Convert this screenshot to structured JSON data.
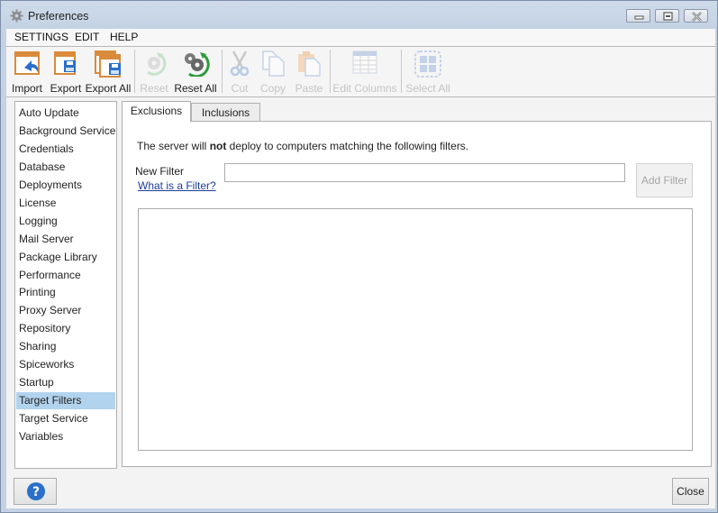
{
  "window": {
    "title": "Preferences",
    "controls": {
      "minimize": "minimize",
      "maximize": "maximize",
      "close": "close"
    }
  },
  "menu": [
    {
      "label": "SETTINGS"
    },
    {
      "label": "EDIT"
    },
    {
      "label": "HELP"
    }
  ],
  "toolbar": {
    "buttons": [
      {
        "label": "Import",
        "icon": "import-icon",
        "enabled": true
      },
      {
        "label": "Export",
        "icon": "export-icon",
        "enabled": true
      },
      {
        "label": "Export All",
        "icon": "export-all-icon",
        "enabled": true
      },
      {
        "label": "Reset",
        "icon": "reset-icon",
        "enabled": false
      },
      {
        "label": "Reset All",
        "icon": "reset-all-icon",
        "enabled": true
      },
      {
        "label": "Cut",
        "icon": "cut-icon",
        "enabled": false
      },
      {
        "label": "Copy",
        "icon": "copy-icon",
        "enabled": false
      },
      {
        "label": "Paste",
        "icon": "paste-icon",
        "enabled": false
      },
      {
        "label": "Edit Columns",
        "icon": "edit-columns-icon",
        "enabled": false
      },
      {
        "label": "Select All",
        "icon": "select-all-icon",
        "enabled": false
      }
    ]
  },
  "sidebar": {
    "items": [
      {
        "label": "Auto Update"
      },
      {
        "label": "Background Service"
      },
      {
        "label": "Credentials"
      },
      {
        "label": "Database"
      },
      {
        "label": "Deployments"
      },
      {
        "label": "License"
      },
      {
        "label": "Logging"
      },
      {
        "label": "Mail Server"
      },
      {
        "label": "Package Library"
      },
      {
        "label": "Performance"
      },
      {
        "label": "Printing"
      },
      {
        "label": "Proxy Server"
      },
      {
        "label": "Repository"
      },
      {
        "label": "Sharing"
      },
      {
        "label": "Spiceworks"
      },
      {
        "label": "Startup"
      },
      {
        "label": "Target Filters",
        "selected": true
      },
      {
        "label": "Target Service"
      },
      {
        "label": "Variables"
      }
    ],
    "selected_color": "#b2d3ee"
  },
  "tabs": [
    {
      "label": "Exclusions",
      "active": true
    },
    {
      "label": "Inclusions",
      "active": false
    }
  ],
  "exclusions": {
    "description_prefix": "The server will ",
    "description_bold": "not",
    "description_suffix": " deploy to computers matching the following filters.",
    "new_filter_label": "New Filter",
    "help_link": "What is a Filter?",
    "new_filter_value": "",
    "add_filter_label": "Add Filter",
    "filters": []
  },
  "footer": {
    "help_icon": "question-icon",
    "close_label": "Close"
  },
  "colors": {
    "accent_orange": "#d98a3a",
    "accent_blue": "#2a6fc9",
    "accent_green": "#2e9a3c",
    "link": "#1a3e9a"
  }
}
